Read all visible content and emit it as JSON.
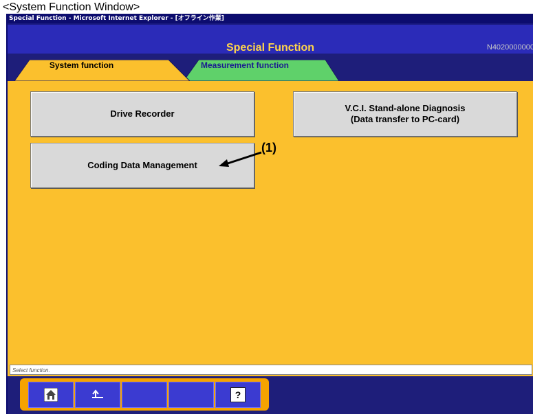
{
  "caption": "<System Function Window>",
  "window_title": "Special Function - Microsoft Internet Explorer - [オフライン作業]",
  "header": {
    "title": "Special Function",
    "id": "N4020000000"
  },
  "tabs": [
    {
      "label": "System function",
      "active": true
    },
    {
      "label": "Measurement function",
      "active": false
    }
  ],
  "buttons": {
    "drive_recorder": "Drive Recorder",
    "vci_line1": "V.C.I. Stand-alone Diagnosis",
    "vci_line2": "(Data transfer to PC-card)",
    "coding": "Coding Data Management"
  },
  "annotation": "(1)",
  "status": "Select function.",
  "toolbar": {
    "icons": [
      "home-icon",
      "back-icon",
      "help-icon"
    ],
    "help_glyph": "?"
  },
  "colors": {
    "background": "#fbc02d",
    "header": "#2b2bb8",
    "title": "#ffd54a",
    "tab_active": "#fbc02d",
    "tab_inactive": "#5fd16a"
  }
}
